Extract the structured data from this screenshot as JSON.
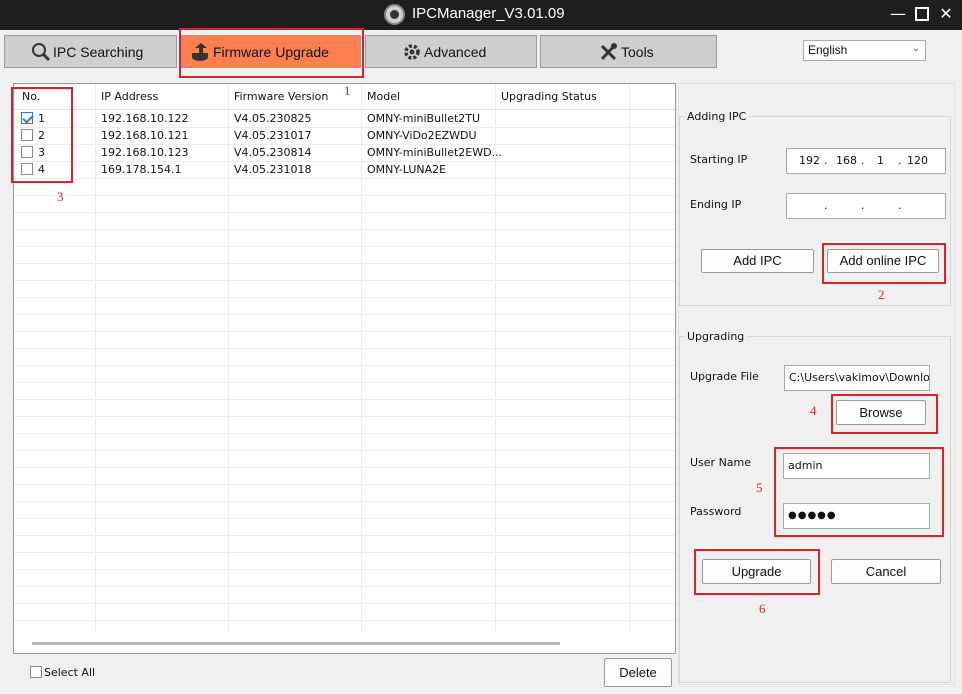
{
  "window": {
    "title": "IPCManager_V3.01.09"
  },
  "tabs": [
    {
      "label": "IPC Searching",
      "icon": "magnifier-icon"
    },
    {
      "label": "Firmware Upgrade",
      "icon": "firmware-upgrade-icon",
      "active": true
    },
    {
      "label": "Advanced",
      "icon": "gears-icon"
    },
    {
      "label": "Tools",
      "icon": "tools-icon"
    }
  ],
  "language": {
    "selected": "English"
  },
  "table": {
    "columns": [
      "No.",
      "IP Address",
      "Firmware Version",
      "Model",
      "Upgrading Status"
    ],
    "rows": [
      {
        "no": "1",
        "ip": "192.168.10.122",
        "firmware": "V4.05.230825",
        "model": "OMNY-miniBullet2TU",
        "status": "",
        "checked": true
      },
      {
        "no": "2",
        "ip": "192.168.10.121",
        "firmware": "V4.05.231017",
        "model": "OMNY-ViDo2EZWDU",
        "status": "",
        "checked": false
      },
      {
        "no": "3",
        "ip": "192.168.10.123",
        "firmware": "V4.05.230814",
        "model": "OMNY-miniBullet2EWD...",
        "status": "",
        "checked": false
      },
      {
        "no": "4",
        "ip": "169.178.154.1",
        "firmware": "V4.05.231018",
        "model": "OMNY-LUNA2E",
        "status": "",
        "checked": false
      }
    ]
  },
  "footer": {
    "select_all": "Select All",
    "delete": "Delete"
  },
  "adding": {
    "title": "Adding IPC",
    "starting_ip_label": "Starting IP",
    "starting_ip": [
      "192",
      "168",
      "1",
      "120"
    ],
    "ending_ip_label": "Ending IP",
    "ending_ip": [
      "",
      "",
      "",
      ""
    ],
    "add_ipc": "Add IPC",
    "add_online_ipc": "Add online IPC"
  },
  "upgrading": {
    "title": "Upgrading",
    "file_label": "Upgrade File",
    "file_value": "C:\\Users\\vakimov\\Downloads",
    "browse": "Browse",
    "user_label": "User Name",
    "user_value": "admin",
    "password_label": "Password",
    "password_value": "●●●●●",
    "upgrade": "Upgrade",
    "cancel": "Cancel"
  },
  "annotations": [
    "1",
    "2",
    "3",
    "4",
    "5",
    "6"
  ],
  "colors": {
    "active_tab": "#ff7f50",
    "annotation_red": "#d9232a",
    "titlebar": "#1e1e1e",
    "checkbox_blue": "#2b7cd3"
  }
}
